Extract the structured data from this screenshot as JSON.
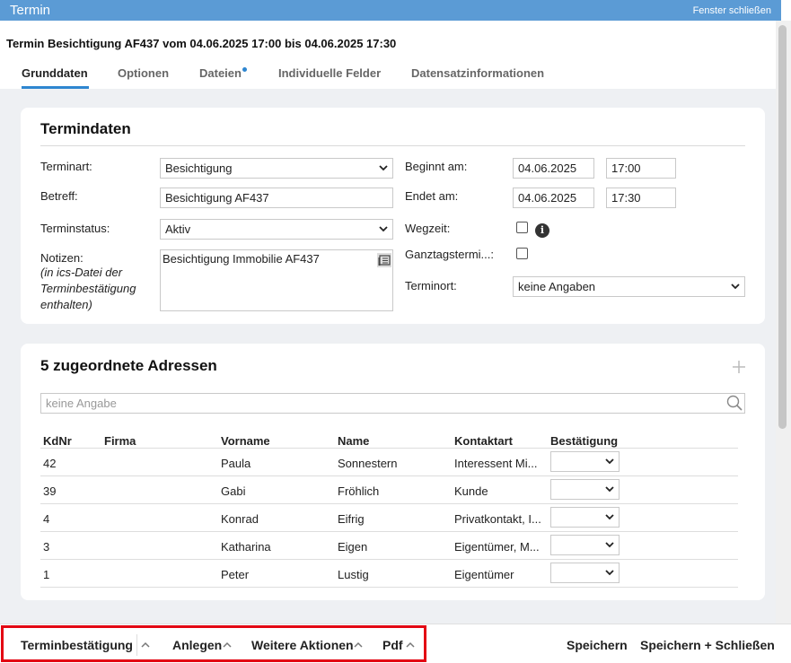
{
  "window": {
    "title": "Termin",
    "close_label": "Fenster schließen"
  },
  "heading": "Termin Besichtigung AF437 vom 04.06.2025 17:00 bis 04.06.2025 17:30",
  "tabs": [
    {
      "label": "Grunddaten",
      "active": true
    },
    {
      "label": "Optionen"
    },
    {
      "label": "Dateien",
      "has_indicator": true
    },
    {
      "label": "Individuelle Felder"
    },
    {
      "label": "Datensatzinformationen"
    }
  ],
  "termindaten": {
    "title": "Termindaten",
    "terminart": {
      "label": "Terminart:",
      "value": "Besichtigung"
    },
    "betreff": {
      "label": "Betreff:",
      "value": "Besichtigung AF437"
    },
    "terminstatus": {
      "label": "Terminstatus:",
      "value": "Aktiv"
    },
    "notizen": {
      "label": "Notizen:",
      "hint": "(in ics-Datei der Terminbestätigung enthalten)",
      "value": "Besichtigung Immobilie AF437"
    },
    "beginnt": {
      "label": "Beginnt am:",
      "date": "04.06.2025",
      "time": "17:00"
    },
    "endet": {
      "label": "Endet am:",
      "date": "04.06.2025",
      "time": "17:30"
    },
    "wegzeit": {
      "label": "Wegzeit:",
      "checked": false
    },
    "ganztag": {
      "label": "Ganztagstermi...:",
      "checked": false
    },
    "terminort": {
      "label": "Terminort:",
      "value": "keine Angaben"
    }
  },
  "adressen": {
    "title": "5 zugeordnete Adressen",
    "search_placeholder": "keine Angabe",
    "columns": [
      "KdNr",
      "Firma",
      "Vorname",
      "Name",
      "Kontaktart",
      "Bestätigung"
    ],
    "rows": [
      {
        "kdnr": "42",
        "firma": "",
        "vorname": "Paula",
        "name": "Sonnestern",
        "kontaktart": "Interessent Mi..."
      },
      {
        "kdnr": "39",
        "firma": "",
        "vorname": "Gabi",
        "name": "Fröhlich",
        "kontaktart": "Kunde"
      },
      {
        "kdnr": "4",
        "firma": "",
        "vorname": "Konrad",
        "name": "Eifrig",
        "kontaktart": "Privatkontakt, I..."
      },
      {
        "kdnr": "3",
        "firma": "",
        "vorname": "Katharina",
        "name": "Eigen",
        "kontaktart": "Eigentümer, M..."
      },
      {
        "kdnr": "1",
        "firma": "",
        "vorname": "Peter",
        "name": "Lustig",
        "kontaktart": "Eigentümer"
      }
    ]
  },
  "footer": {
    "terminbestaetigung": "Terminbestätigung",
    "anlegen": "Anlegen",
    "weitere": "Weitere Aktionen",
    "pdf": "Pdf",
    "speichern": "Speichern",
    "speichern_schliessen": "Speichern + Schließen"
  },
  "colors": {
    "titlebar": "#5b9bd5",
    "accent": "#2e86d0",
    "highlight": "#e30613",
    "background": "#eef0f3"
  }
}
